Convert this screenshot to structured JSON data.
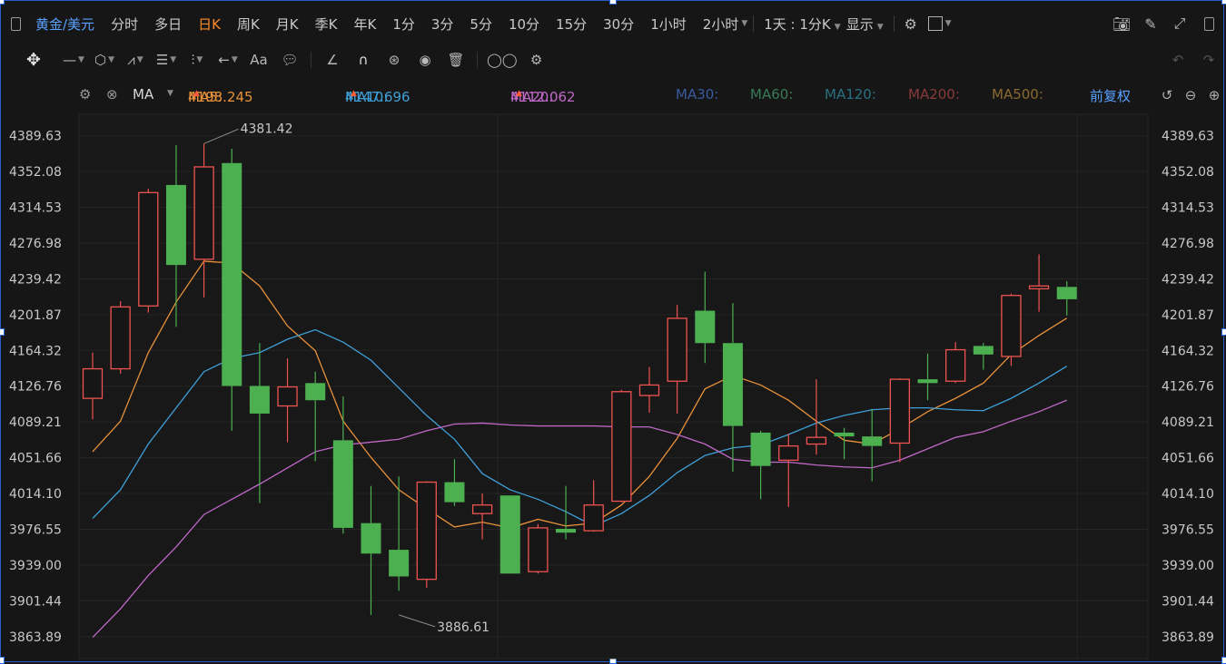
{
  "toolbar": {
    "symbol": "黄金/美元",
    "periods": [
      "分时",
      "多日",
      "日K",
      "周K",
      "月K",
      "季K",
      "年K",
      "1分",
      "3分",
      "5分",
      "10分",
      "15分",
      "30分",
      "1小时",
      "2小时"
    ],
    "active_period": "日K",
    "interval_label": "1天 : 1分K",
    "display_label": "显示"
  },
  "ma_bar": {
    "indicator": "MA",
    "ma5_label": "MA5:",
    "ma5_value": "4198.245",
    "ma10_label": "MA10:",
    "ma10_value": "4147.696",
    "ma20_label": "MA20:",
    "ma20_value": "4112.062",
    "ma30_label": "MA30:",
    "ma60_label": "MA60:",
    "ma120_label": "MA120:",
    "ma200_label": "MA200:",
    "ma500_label": "MA500:",
    "adjust_label": "前复权"
  },
  "colors": {
    "up": "#ef5350",
    "down": "#4caf50",
    "ma5": "#e8913a",
    "ma10": "#3fa0d8",
    "ma20": "#c068c8",
    "ma30": "#3a5aa0",
    "ma60": "#3a7a5a",
    "ma120": "#2a7080",
    "ma200": "#8a3a3a",
    "ma500": "#8a6a30"
  },
  "chart_data": {
    "type": "candlestick",
    "y_ticks": [
      4389.63,
      4352.08,
      4314.53,
      4276.98,
      4239.42,
      4201.87,
      4164.32,
      4126.76,
      4089.21,
      4051.66,
      4014.1,
      3976.55,
      3939.0,
      3901.44,
      3863.89
    ],
    "y_tick_labels": [
      "4389.63",
      "4352.08",
      "4314.53",
      "4276.98",
      "4239.42",
      "4201.87",
      "4164.32",
      "4126.76",
      "4089.21",
      "4051.66",
      "4014.10",
      "3976.55",
      "3939.00",
      "3901.44",
      "3863.89"
    ],
    "ylim": [
      3840.8,
      4412.2
    ],
    "grid": true,
    "annotations": [
      {
        "text": "4381.42",
        "candle": 4,
        "value": 4381.42
      },
      {
        "text": "3886.61",
        "candle": 11,
        "value": 3886.61
      }
    ],
    "candles": [
      {
        "o": 4114,
        "h": 4162,
        "l": 4092,
        "c": 4145
      },
      {
        "o": 4145,
        "h": 4216,
        "l": 4140,
        "c": 4210
      },
      {
        "o": 4211,
        "h": 4334,
        "l": 4204,
        "c": 4330
      },
      {
        "o": 4338,
        "h": 4380,
        "l": 4189,
        "c": 4254
      },
      {
        "o": 4260,
        "h": 4381.42,
        "l": 4220,
        "c": 4357
      },
      {
        "o": 4361,
        "h": 4376,
        "l": 4080,
        "c": 4127
      },
      {
        "o": 4127,
        "h": 4172,
        "l": 4004,
        "c": 4098
      },
      {
        "o": 4106,
        "h": 4156,
        "l": 4068,
        "c": 4126
      },
      {
        "o": 4130,
        "h": 4142,
        "l": 4048,
        "c": 4112
      },
      {
        "o": 4070,
        "h": 4116,
        "l": 3972,
        "c": 3978
      },
      {
        "o": 3983,
        "h": 4022,
        "l": 3886.61,
        "c": 3951
      },
      {
        "o": 3955,
        "h": 4032,
        "l": 3912,
        "c": 3927
      },
      {
        "o": 3924,
        "h": 4027,
        "l": 3915,
        "c": 4026
      },
      {
        "o": 4026,
        "h": 4050,
        "l": 4001,
        "c": 4005
      },
      {
        "o": 3993,
        "h": 4014,
        "l": 3966,
        "c": 4002
      },
      {
        "o": 4012,
        "h": 4011,
        "l": 3930,
        "c": 3930
      },
      {
        "o": 3932,
        "h": 3982,
        "l": 3930,
        "c": 3978
      },
      {
        "o": 3977,
        "h": 4022,
        "l": 3966,
        "c": 3973
      },
      {
        "o": 3975,
        "h": 4028,
        "l": 3974,
        "c": 4002
      },
      {
        "o": 4006,
        "h": 4123,
        "l": 4005,
        "c": 4121
      },
      {
        "o": 4117,
        "h": 4147,
        "l": 4099,
        "c": 4128
      },
      {
        "o": 4132,
        "h": 4212,
        "l": 4098,
        "c": 4198
      },
      {
        "o": 4206,
        "h": 4247,
        "l": 4151,
        "c": 4172
      },
      {
        "o": 4172,
        "h": 4214,
        "l": 4037,
        "c": 4085
      },
      {
        "o": 4078,
        "h": 4080,
        "l": 4008,
        "c": 4043
      },
      {
        "o": 4049,
        "h": 4077,
        "l": 4000,
        "c": 4064
      },
      {
        "o": 4066,
        "h": 4134,
        "l": 4055,
        "c": 4073
      },
      {
        "o": 4078,
        "h": 4083,
        "l": 4050,
        "c": 4074
      },
      {
        "o": 4074,
        "h": 4103,
        "l": 4027,
        "c": 4064
      },
      {
        "o": 4067,
        "h": 4135,
        "l": 4047,
        "c": 4134
      },
      {
        "o": 4134,
        "h": 4161,
        "l": 4112,
        "c": 4130
      },
      {
        "o": 4132,
        "h": 4173,
        "l": 4130,
        "c": 4165
      },
      {
        "o": 4169,
        "h": 4172,
        "l": 4144,
        "c": 4160
      },
      {
        "o": 4158,
        "h": 4224,
        "l": 4148,
        "c": 4222
      },
      {
        "o": 4229,
        "h": 4265,
        "l": 4205,
        "c": 4232
      },
      {
        "o": 4231,
        "h": 4237,
        "l": 4201,
        "c": 4218
      }
    ],
    "series": [
      {
        "name": "MA5",
        "values": [
          4058,
          4090,
          4162,
          4215,
          4258,
          4256,
          4232,
          4190,
          4164,
          4090,
          4052,
          4018,
          3998,
          3979,
          3984,
          3978,
          3987,
          3980,
          3983,
          4002,
          4032,
          4072,
          4124,
          4138,
          4128,
          4112,
          4090,
          4070,
          4066,
          4082,
          4100,
          4114,
          4130,
          4160,
          4180,
          4198.245
        ]
      },
      {
        "name": "MA10",
        "values": [
          3988,
          4018,
          4066,
          4104,
          4142,
          4156,
          4162,
          4176,
          4186,
          4173,
          4154,
          4125,
          4096,
          4071,
          4035,
          4018,
          4008,
          3995,
          3980,
          3993,
          4012,
          4036,
          4054,
          4062,
          4065,
          4076,
          4088,
          4096,
          4102,
          4104,
          4104,
          4102,
          4101,
          4114,
          4130,
          4147.696
        ]
      },
      {
        "name": "MA20",
        "values": [
          3863,
          3893,
          3928,
          3958,
          3992,
          4008,
          4024,
          4041,
          4058,
          4065,
          4068,
          4071,
          4080,
          4087,
          4088,
          4086,
          4085,
          4085,
          4085,
          4084,
          4084,
          4076,
          4066,
          4050,
          4047,
          4047,
          4044,
          4042,
          4041,
          4049,
          4061,
          4073,
          4079,
          4090,
          4100,
          4112.062
        ]
      }
    ]
  }
}
